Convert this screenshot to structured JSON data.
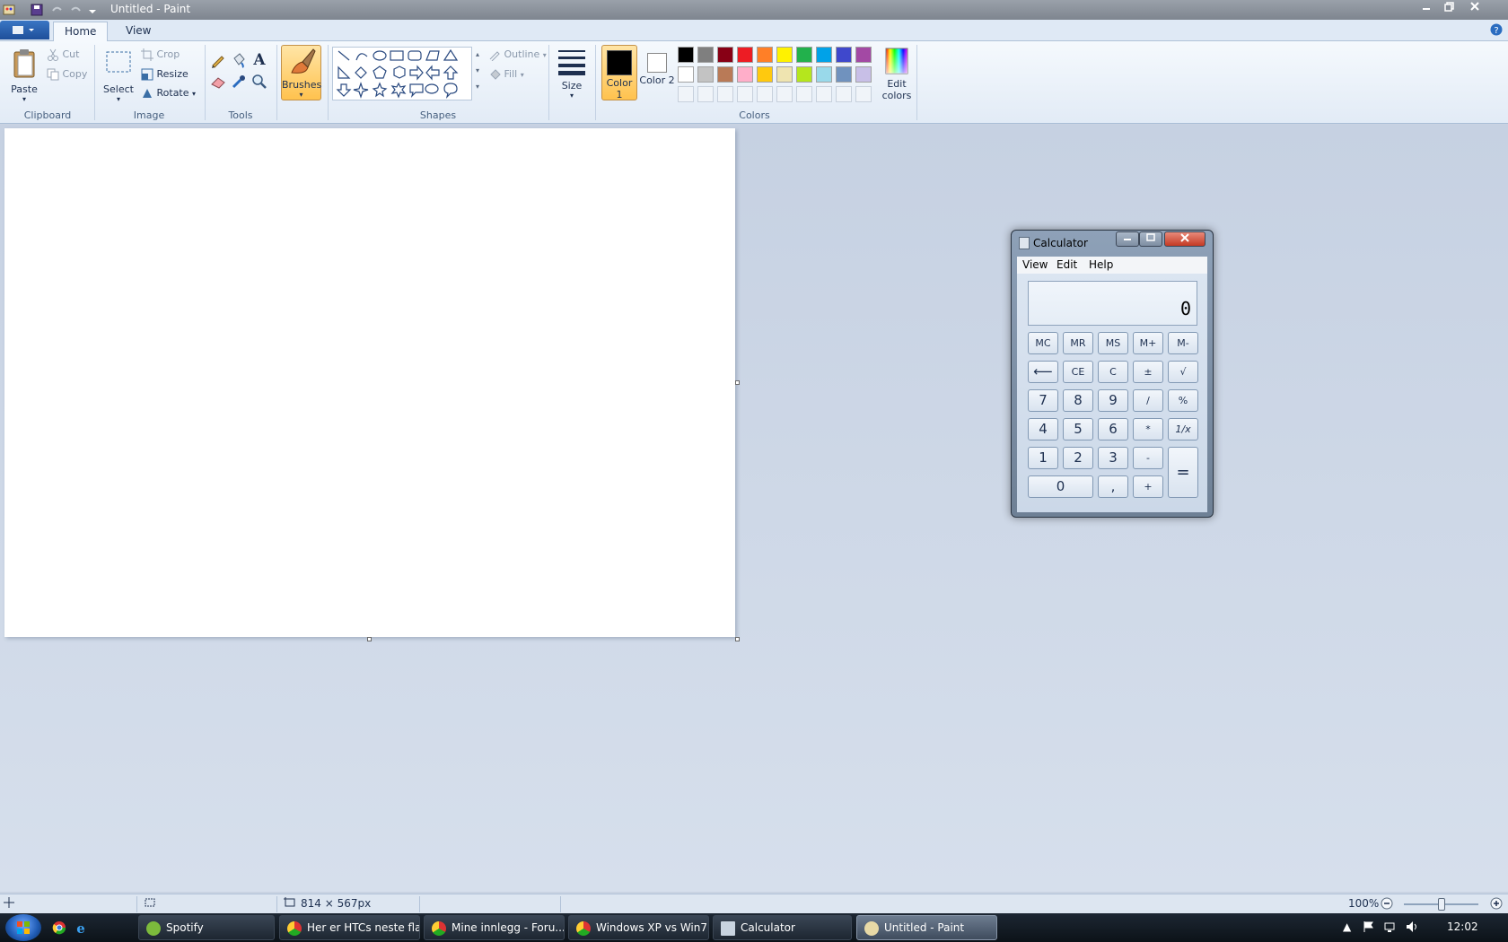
{
  "window": {
    "title": "Untitled - Paint"
  },
  "tabs": {
    "home": "Home",
    "view": "View"
  },
  "clipboard": {
    "paste": "Paste",
    "cut": "Cut",
    "copy": "Copy",
    "label": "Clipboard"
  },
  "image": {
    "select": "Select",
    "crop": "Crop",
    "resize": "Resize",
    "rotate": "Rotate",
    "label": "Image"
  },
  "tools": {
    "label": "Tools",
    "text_glyph": "A"
  },
  "brushes": {
    "label": "Brushes"
  },
  "shapes": {
    "outline": "Outline",
    "fill": "Fill",
    "label": "Shapes"
  },
  "size": {
    "label": "Size"
  },
  "colors": {
    "color1": "Color 1",
    "color2": "Color 2",
    "edit": "Edit colors",
    "label": "Colors",
    "color1_value": "#000000",
    "color2_value": "#ffffff",
    "row1": [
      "#000000",
      "#7f7f7f",
      "#880015",
      "#ed1c24",
      "#ff7f27",
      "#fff200",
      "#22b14c",
      "#00a2e8",
      "#3f48cc",
      "#a349a4"
    ],
    "row2": [
      "#ffffff",
      "#c3c3c3",
      "#b97a57",
      "#ffaec9",
      "#ffc90e",
      "#efe4b0",
      "#b5e61d",
      "#99d9ea",
      "#7092be",
      "#c8bfe7"
    ]
  },
  "calculator": {
    "title": "Calculator",
    "menu": {
      "view": "View",
      "edit": "Edit",
      "help": "Help"
    },
    "display": "0",
    "keys": {
      "mc": "MC",
      "mr": "MR",
      "ms": "MS",
      "mplus": "M+",
      "mminus": "M-",
      "back": "⟵",
      "ce": "CE",
      "c": "C",
      "sign": "±",
      "sqrt": "√",
      "k7": "7",
      "k8": "8",
      "k9": "9",
      "div": "/",
      "pct": "%",
      "k4": "4",
      "k5": "5",
      "k6": "6",
      "mul": "*",
      "inv": "1/x",
      "k1": "1",
      "k2": "2",
      "k3": "3",
      "sub": "-",
      "eq": "=",
      "k0": "0",
      "dec": ",",
      "add": "+"
    }
  },
  "status": {
    "size": "814 × 567px",
    "zoom": "100%"
  },
  "taskbar": {
    "items": [
      "Spotify",
      "Her er HTCs neste fla...",
      "Mine innlegg - Foru...",
      "Windows XP vs Win7...",
      "Calculator",
      "Untitled - Paint"
    ],
    "clock": "12:02"
  }
}
